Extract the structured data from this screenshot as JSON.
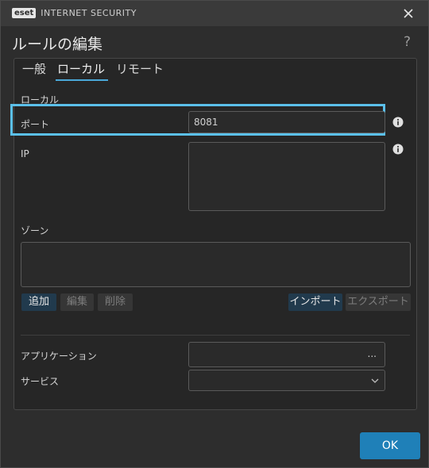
{
  "window": {
    "brand_badge": "eset",
    "brand_text": "INTERNET SECURITY"
  },
  "dialog": {
    "title": "ルールの編集",
    "help": "?"
  },
  "tabs": [
    {
      "label": "一般"
    },
    {
      "label": "ローカル"
    },
    {
      "label": "リモート"
    }
  ],
  "local": {
    "section_label": "ローカル",
    "port_label": "ポート",
    "port_value": "8081",
    "ip_label": "IP",
    "zone_label": "ゾーン",
    "buttons": {
      "add": "追加",
      "edit": "編集",
      "delete": "削除",
      "import": "インポート",
      "export": "エクスポート"
    },
    "application_label": "アプリケーション",
    "application_browse": "...",
    "service_label": "サービス"
  },
  "footer": {
    "ok": "OK"
  },
  "colors": {
    "accent": "#1f80b8",
    "highlight": "#5bc0ea",
    "tab_underline": "#4aa8d8"
  }
}
